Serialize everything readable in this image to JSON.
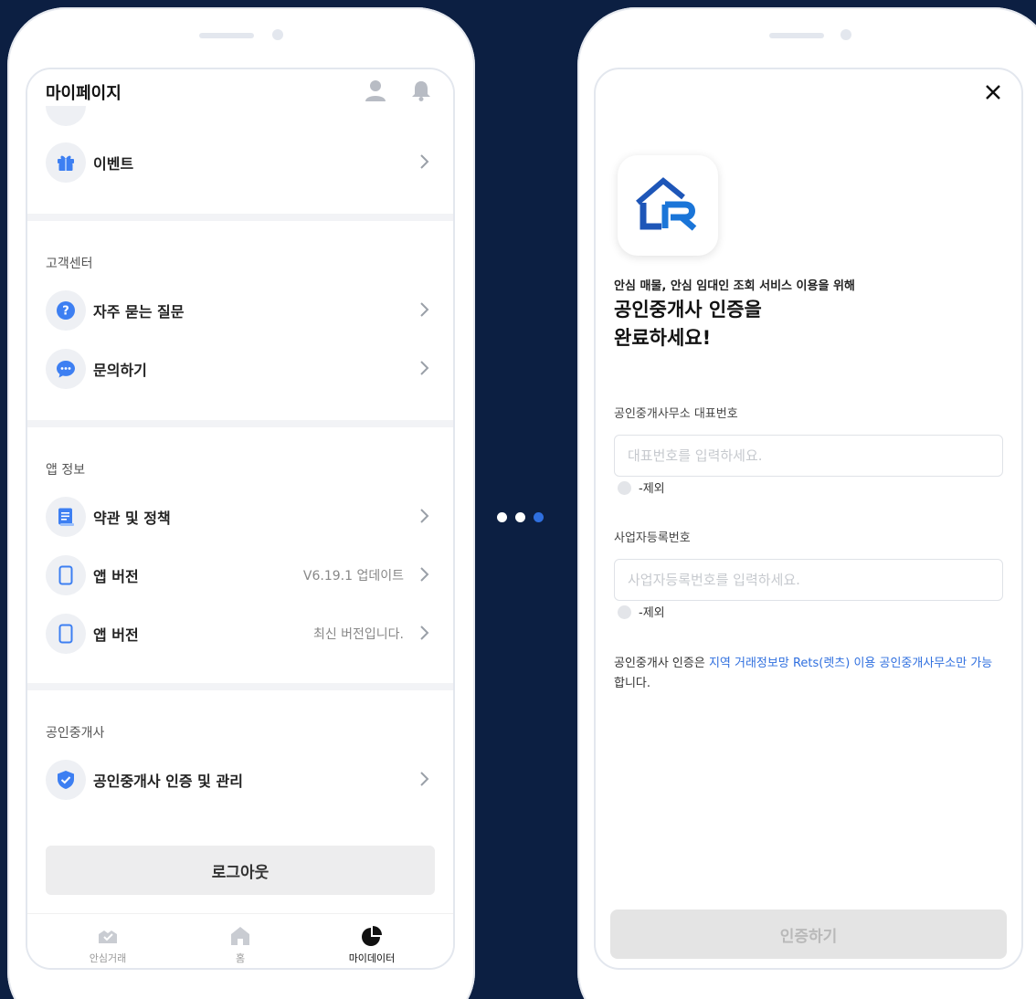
{
  "mypage": {
    "title": "마이페이지",
    "event_label": "이벤트",
    "customer_center_title": "고객센터",
    "faq_label": "자주 묻는 질문",
    "inquiry_label": "문의하기",
    "app_info_title": "앱 정보",
    "terms_label": "약관 및 정책",
    "version_rows": [
      {
        "label": "앱 버전",
        "value": "V6.19.1 업데이트"
      },
      {
        "label": "앱 버전",
        "value": "최신 버전입니다."
      }
    ],
    "broker_title": "공인중개사",
    "broker_label": "공인중개사 인증 및 관리",
    "logout_label": "로그아웃",
    "tabs": [
      {
        "label": "안심거래",
        "icon": "handshake-icon"
      },
      {
        "label": "홈",
        "icon": "home-icon"
      },
      {
        "label": "마이데이터",
        "icon": "pie-chart-icon"
      }
    ]
  },
  "pager": {
    "count": 3,
    "active_index": 2,
    "active_color": "#2f6fdf",
    "inactive_color": "#ffffff"
  },
  "verify": {
    "subtitle": "안심 매물, 안심 임대인 조회 서비스 이용을 위해",
    "headline_1": "공인중개사 인증을",
    "headline_2": "완료하세요!",
    "office_number_label": "공인중개사무소 대표번호",
    "office_number_placeholder": "대표번호를 입력하세요.",
    "office_number_hint": "-제외",
    "biz_number_label": "사업자등록번호",
    "biz_number_placeholder": "사업자등록번호를 입력하세요.",
    "biz_number_hint": "-제외",
    "notice_prefix": "공인중개사 인증은 ",
    "notice_highlight": "지역 거래정보망 Rets(렛츠) 이용 공인중개사무소만 가능",
    "notice_suffix": "합니다.",
    "submit_label": "인증하기"
  },
  "colors": {
    "background": "#0c1f42",
    "accent": "#2f6fdf",
    "icon_blue": "#3d7ff2"
  }
}
